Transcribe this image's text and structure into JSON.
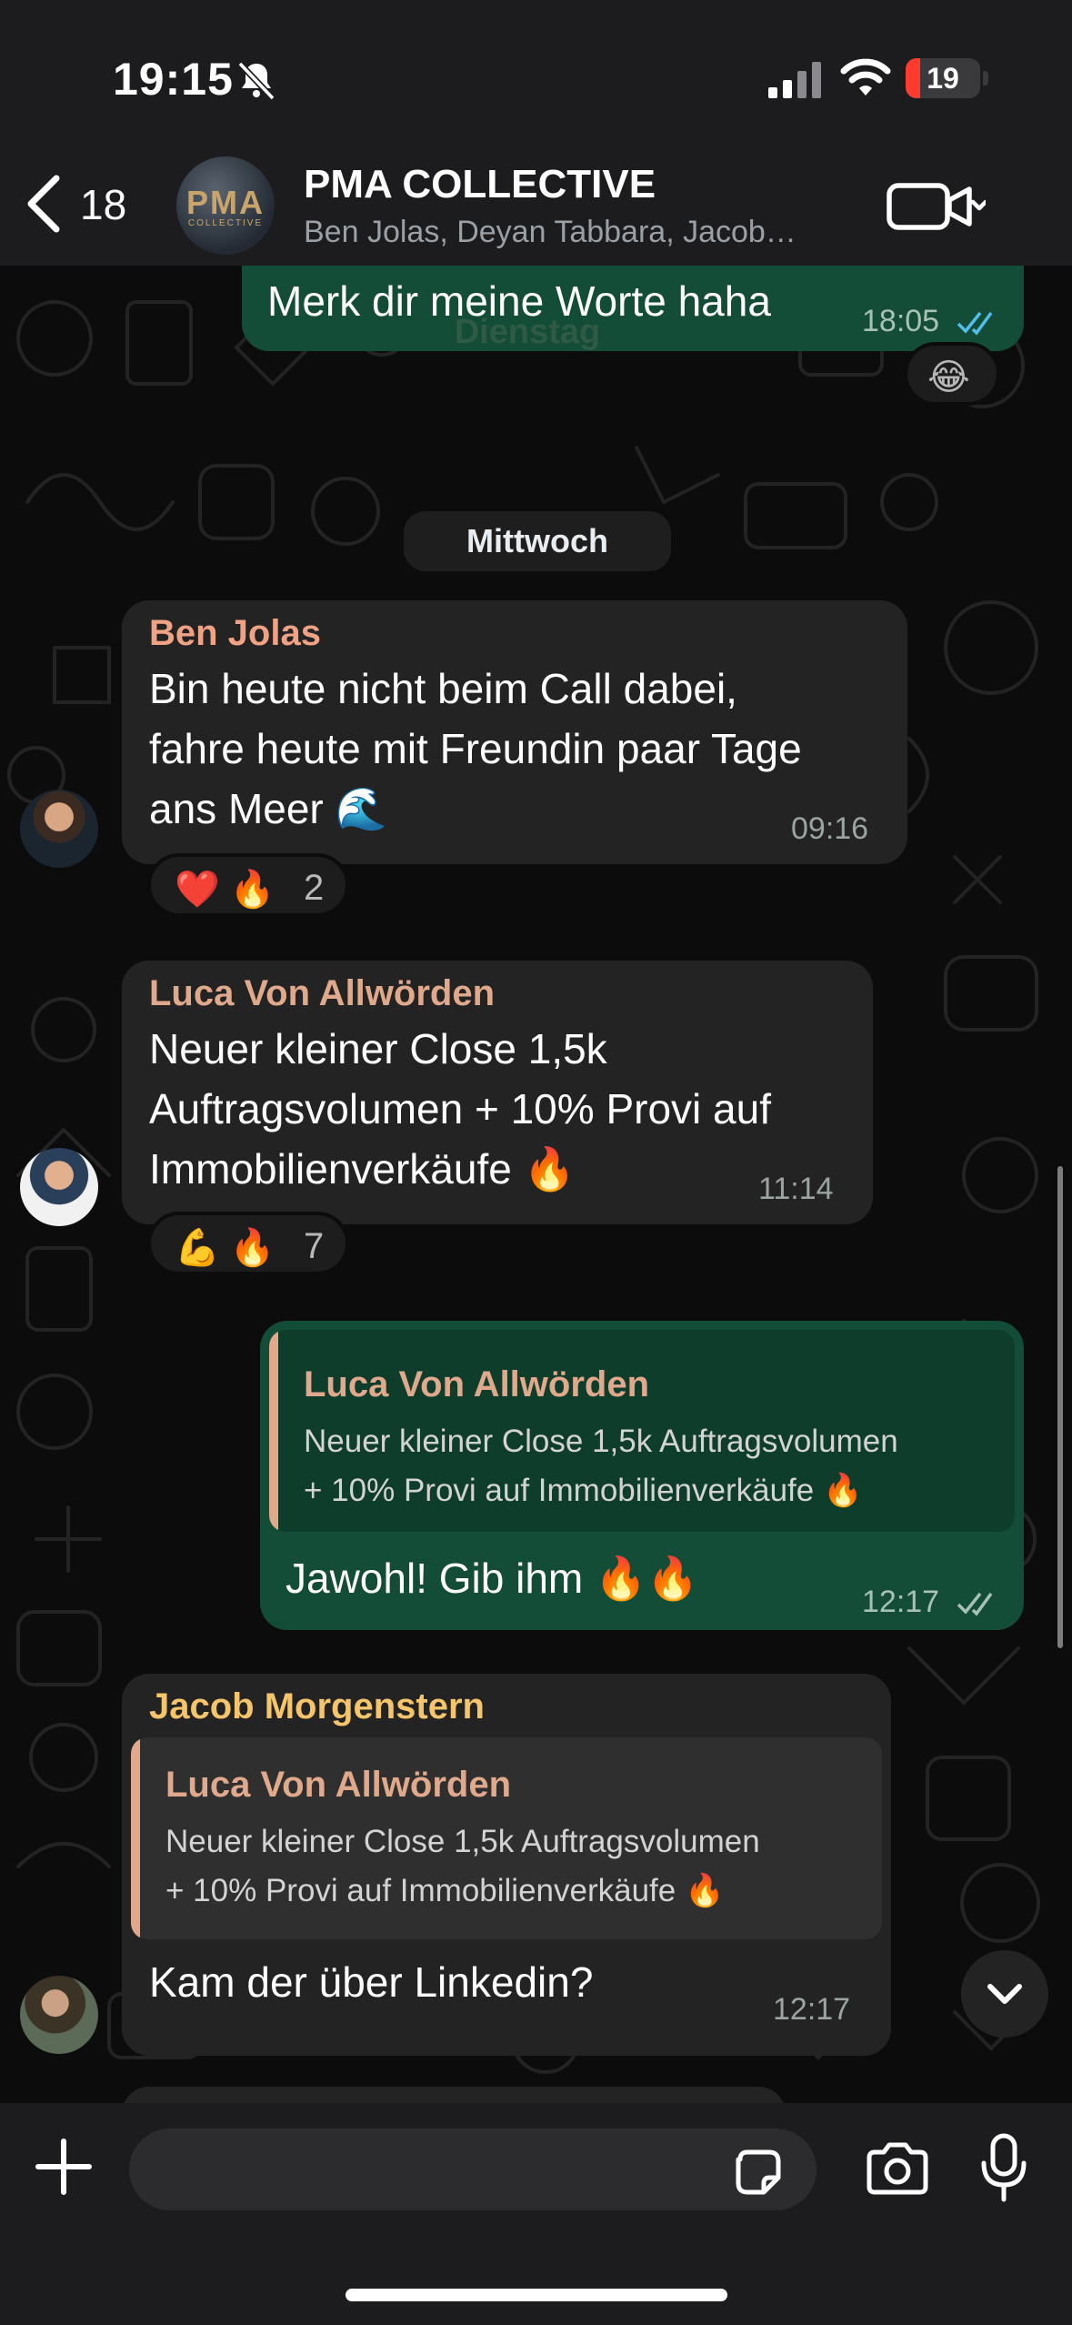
{
  "status_bar": {
    "time": "19:15",
    "battery": "19",
    "battery_level": 0.19
  },
  "header": {
    "back_count": "18",
    "title": "PMA COLLECTIVE",
    "subtitle": "Ben Jolas, Deyan Tabbara, Jacob…",
    "avatar_logo": "PMA",
    "avatar_logo_sub": "COLLECTIVE"
  },
  "messages": [
    {
      "id": "m0",
      "direction": "outgoing",
      "text": "Merk dir meine Worte haha",
      "time": "18:05",
      "status": "read",
      "reaction": "😂"
    },
    {
      "id": "day-dienstag",
      "type": "day",
      "label": "Dienstag"
    },
    {
      "id": "day-mittwoch",
      "type": "day",
      "label": "Mittwoch"
    },
    {
      "id": "m1",
      "direction": "incoming",
      "sender": "Ben Jolas",
      "sender_color": "#f0a285",
      "lines": [
        "Bin heute nicht beim Call dabei,",
        "fahre heute mit Freundin paar Tage",
        "ans Meer 🌊"
      ],
      "time": "09:16",
      "reactions": {
        "emojis": "❤️ 🔥",
        "count": "2"
      }
    },
    {
      "id": "m2",
      "direction": "incoming",
      "sender": "Luca Von Allwörden",
      "sender_color": "#e0a98c",
      "lines": [
        "Neuer kleiner Close 1,5k",
        "Auftragsvolumen + 10% Provi auf",
        "Immobilienverkäufe 🔥"
      ],
      "time": "11:14",
      "reactions": {
        "emojis": "💪 🔥",
        "count": "7"
      }
    },
    {
      "id": "m3",
      "direction": "outgoing",
      "quote": {
        "name": "Luca Von Allwörden",
        "lines": [
          "Neuer kleiner Close 1,5k Auftragsvolumen",
          "+ 10% Provi auf Immobilienverkäufe 🔥"
        ]
      },
      "text": "Jawohl! Gib ihm 🔥🔥",
      "time": "12:17",
      "status": "delivered"
    },
    {
      "id": "m4",
      "direction": "incoming",
      "sender": "Jacob Morgenstern",
      "sender_color": "#f5c56b",
      "quote": {
        "name": "Luca Von Allwörden",
        "lines": [
          "Neuer kleiner Close 1,5k Auftragsvolumen",
          "+ 10% Provi auf Immobilienverkäufe 🔥"
        ]
      },
      "text": "Kam der über Linkedin?",
      "time": "12:17"
    }
  ],
  "input": {
    "value": "",
    "placeholder": ""
  },
  "icons": [
    "bell-slash-icon",
    "signal-icon",
    "wifi-icon",
    "chevron-left-icon",
    "video-call-icon",
    "chevron-down-icon",
    "plus-icon",
    "sticker-icon",
    "camera-icon",
    "microphone-icon",
    "double-check-icon"
  ]
}
